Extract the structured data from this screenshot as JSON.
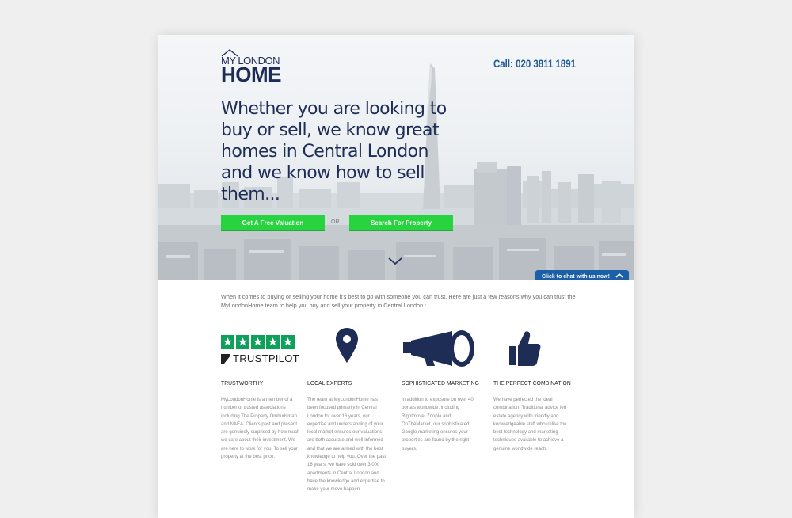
{
  "logo": {
    "top": "MY LONDON",
    "bottom": "HOME"
  },
  "header": {
    "phone": "Call: 020 3811 1891"
  },
  "hero": {
    "headline": "Whether you are looking to buy or sell, we know great homes in Central London and we know how to sell them...",
    "btn_valuation": "Get A Free Valuation",
    "or_label": "OR",
    "btn_search": "Search For Property"
  },
  "chat": {
    "label": "Click to chat with us now!"
  },
  "intro": "When it comes to buying or selling your home it's best to go with someone you can trust. Here are just a few reasons why you can trust the MyLondonHome team to help you buy and sell your property in Central London :",
  "features": [
    {
      "title": "TRUSTWORTHY",
      "text": "MyLondonHome is a member of a number of trusted associations including The Property Ombudsman and NAEA. Clients past and present are genuinely surprised by how much we care about their investment. We are here to work for you! To sell your property at the best price."
    },
    {
      "title": "LOCAL EXPERTS",
      "text": "The team at MyLondonHome has been focused primarily in Central London for over 16 years, our expertise and understanding of your local market ensures our valuations are both accurate and well-informed and that we are armed with the best knowledge to help you. Over the past 16 years, we have sold over 3,000 apartments in Central London and have the knowledge and expertise to make your move happen."
    },
    {
      "title": "SOPHISTICATED MARKETING",
      "text": "In addition to exposure on over 40 portals worldwide, including Rightmove, Zoopla and OnTheMarket, our sophisticated Google marketing ensures your properties are found by the right buyers."
    },
    {
      "title": "THE PERFECT COMBINATION",
      "text": "We have perfected the ideal combination. Traditional advice led estate agency with friendly and knowledgeable staff who utilise the best technology and marketing techniques available to achieve a genuine worldwide reach."
    }
  ],
  "trustpilot": {
    "word": "TRUSTPILOT"
  },
  "icons": {
    "stars": "star-icon",
    "pin": "location-pin-icon",
    "megaphone": "megaphone-icon",
    "thumb": "thumbs-up-icon",
    "chevron": "chevron-down-icon"
  },
  "colors": {
    "navy": "#1e2d55",
    "green": "#27d43f",
    "chat_blue": "#1a5fa8",
    "trustpilot_green": "#0ea15a"
  }
}
